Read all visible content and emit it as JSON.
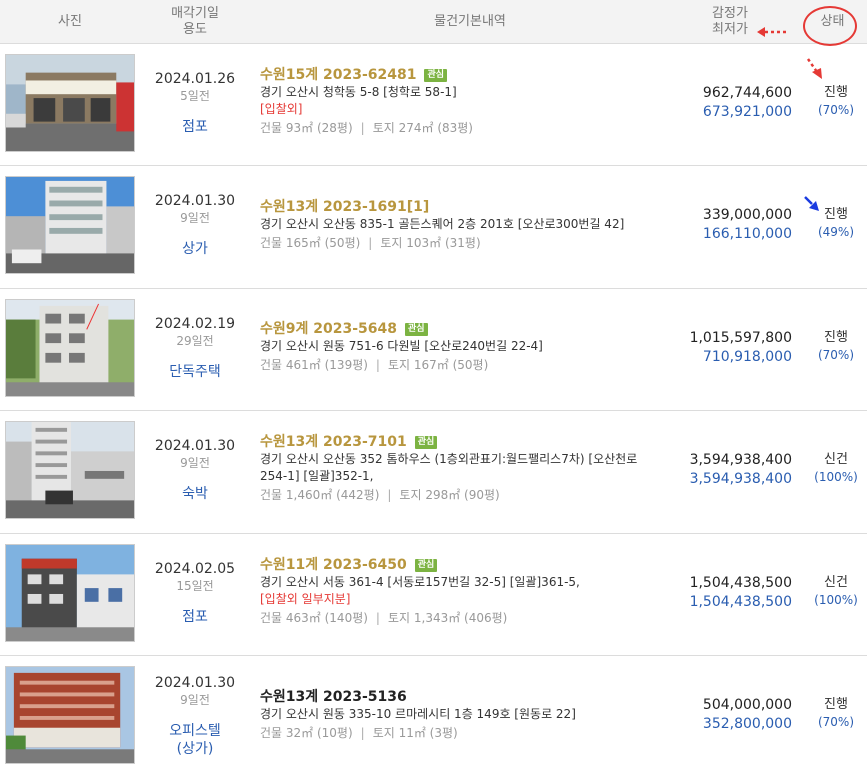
{
  "header": {
    "photo": "사진",
    "date_line1": "매각기일",
    "date_line2": "용도",
    "basic": "물건기본내역",
    "price_line1": "감정가",
    "price_line2": "최저가",
    "status": "상태"
  },
  "rows": [
    {
      "date": "2024.01.26",
      "days": "5일전",
      "use": "점포",
      "case": "수원15계 2023-62481",
      "badge": "관심",
      "addr": "경기 오산시 청학동 5-8 [청학로 58-1]",
      "warn": "[입찰외]",
      "building": "건물 93㎡ (28평)",
      "land": "토지 274㎡ (83평)",
      "appraisal": "962,744,600",
      "minimum": "673,921,000",
      "status": "진행",
      "percent": "(70%)"
    },
    {
      "date": "2024.01.30",
      "days": "9일전",
      "use": "상가",
      "case": "수원13계 2023-1691[1]",
      "badge": "",
      "addr": "경기 오산시 오산동 835-1 골든스퀘어 2층 201호 [오산로300번길 42]",
      "warn": "",
      "building": "건물 165㎡ (50평)",
      "land": "토지 103㎡ (31평)",
      "appraisal": "339,000,000",
      "minimum": "166,110,000",
      "status": "진행",
      "percent": "(49%)"
    },
    {
      "date": "2024.02.19",
      "days": "29일전",
      "use": "단독주택",
      "case": "수원9계 2023-5648",
      "badge": "관심",
      "addr": "경기 오산시 원동 751-6 다원빌 [오산로240번길 22-4]",
      "warn": "",
      "building": "건물 461㎡ (139평)",
      "land": "토지 167㎡ (50평)",
      "appraisal": "1,015,597,800",
      "minimum": "710,918,000",
      "status": "진행",
      "percent": "(70%)"
    },
    {
      "date": "2024.01.30",
      "days": "9일전",
      "use": "숙박",
      "case": "수원13계 2023-7101",
      "badge": "관심",
      "addr": "경기 오산시 오산동 352 톰하우스 (1층외관표기:월드팰리스7차) [오산천로 254-1] [일괄]352-1,",
      "warn": "",
      "building": "건물 1,460㎡ (442평)",
      "land": "토지 298㎡ (90평)",
      "appraisal": "3,594,938,400",
      "minimum": "3,594,938,400",
      "status": "신건",
      "percent": "(100%)"
    },
    {
      "date": "2024.02.05",
      "days": "15일전",
      "use": "점포",
      "case": "수원11계 2023-6450",
      "badge": "관심",
      "addr": "경기 오산시 서동 361-4 [서동로157번길 32-5] [일괄]361-5,",
      "warn": "[입찰외 일부지분]",
      "building": "건물 463㎡ (140평)",
      "land": "토지 1,343㎡ (406평)",
      "appraisal": "1,504,438,500",
      "minimum": "1,504,438,500",
      "status": "신건",
      "percent": "(100%)"
    },
    {
      "date": "2024.01.30",
      "days": "9일전",
      "use": "오피스텔\n(상가)",
      "case": "수원13계 2023-5136",
      "badge": "",
      "addr": "경기 오산시 원동 335-10 르마레시티 1층 149호 [원동로 22]",
      "warn": "",
      "building": "건물 32㎡ (10평)",
      "land": "토지 11㎡ (3평)",
      "appraisal": "504,000,000",
      "minimum": "352,800,000",
      "status": "진행",
      "percent": "(70%)"
    }
  ]
}
